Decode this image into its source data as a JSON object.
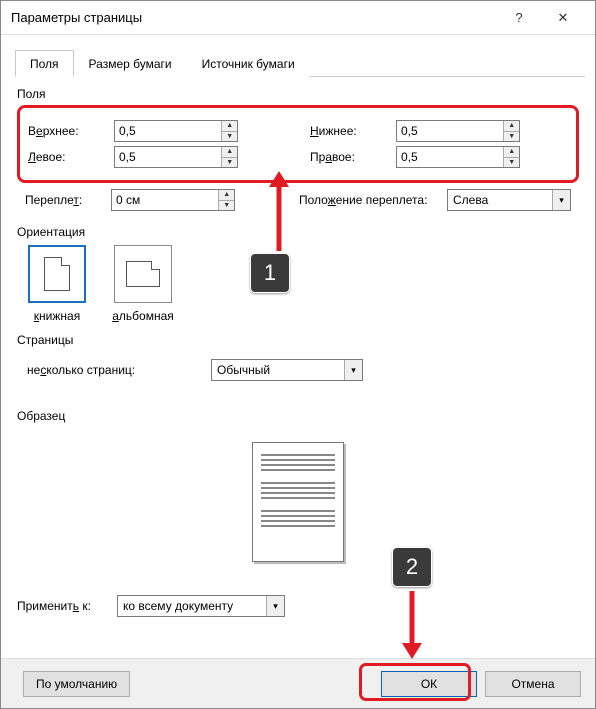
{
  "window": {
    "title": "Параметры страницы"
  },
  "tabs": {
    "margins": "Поля",
    "paper": "Размер бумаги",
    "source": "Источник бумаги"
  },
  "margins": {
    "section": "Поля",
    "top_label_pre": "В",
    "top_label_u": "е",
    "top_label_post": "рхнее:",
    "bottom_label_u": "Н",
    "bottom_label_post": "ижнее:",
    "left_label_u": "Л",
    "left_label_post": "евое:",
    "right_label_post_pre": "Пр",
    "right_label_u": "а",
    "right_label_post": "вое:",
    "top": "0,5",
    "bottom": "0,5",
    "left": "0,5",
    "right": "0,5",
    "gutter_label": "Перепле",
    "gutter_label_u": "т",
    "gutter_label_post": ":",
    "gutter": "0 см",
    "gutter_pos_label": "Поло",
    "gutter_pos_u": "ж",
    "gutter_pos_post": "ение переплета:",
    "gutter_pos": "Слева"
  },
  "orientation": {
    "section": "Ориентация",
    "portrait_u": "к",
    "portrait_post": "нижная",
    "landscape_u": "а",
    "landscape_post": "льбомная"
  },
  "pages": {
    "section": "Страницы",
    "multi_label_pre": "не",
    "multi_label_u": "с",
    "multi_label_post": "колько страниц:",
    "multi_value": "Обычный"
  },
  "sample": {
    "section": "Образец"
  },
  "apply": {
    "label": "Применит",
    "label_u": "ь",
    "label_post": " к:",
    "value": "ко всему документу"
  },
  "footer": {
    "defaults": "По умолчанию",
    "ok": "ОК",
    "cancel": "Отмена"
  },
  "callouts": {
    "one": "1",
    "two": "2"
  }
}
